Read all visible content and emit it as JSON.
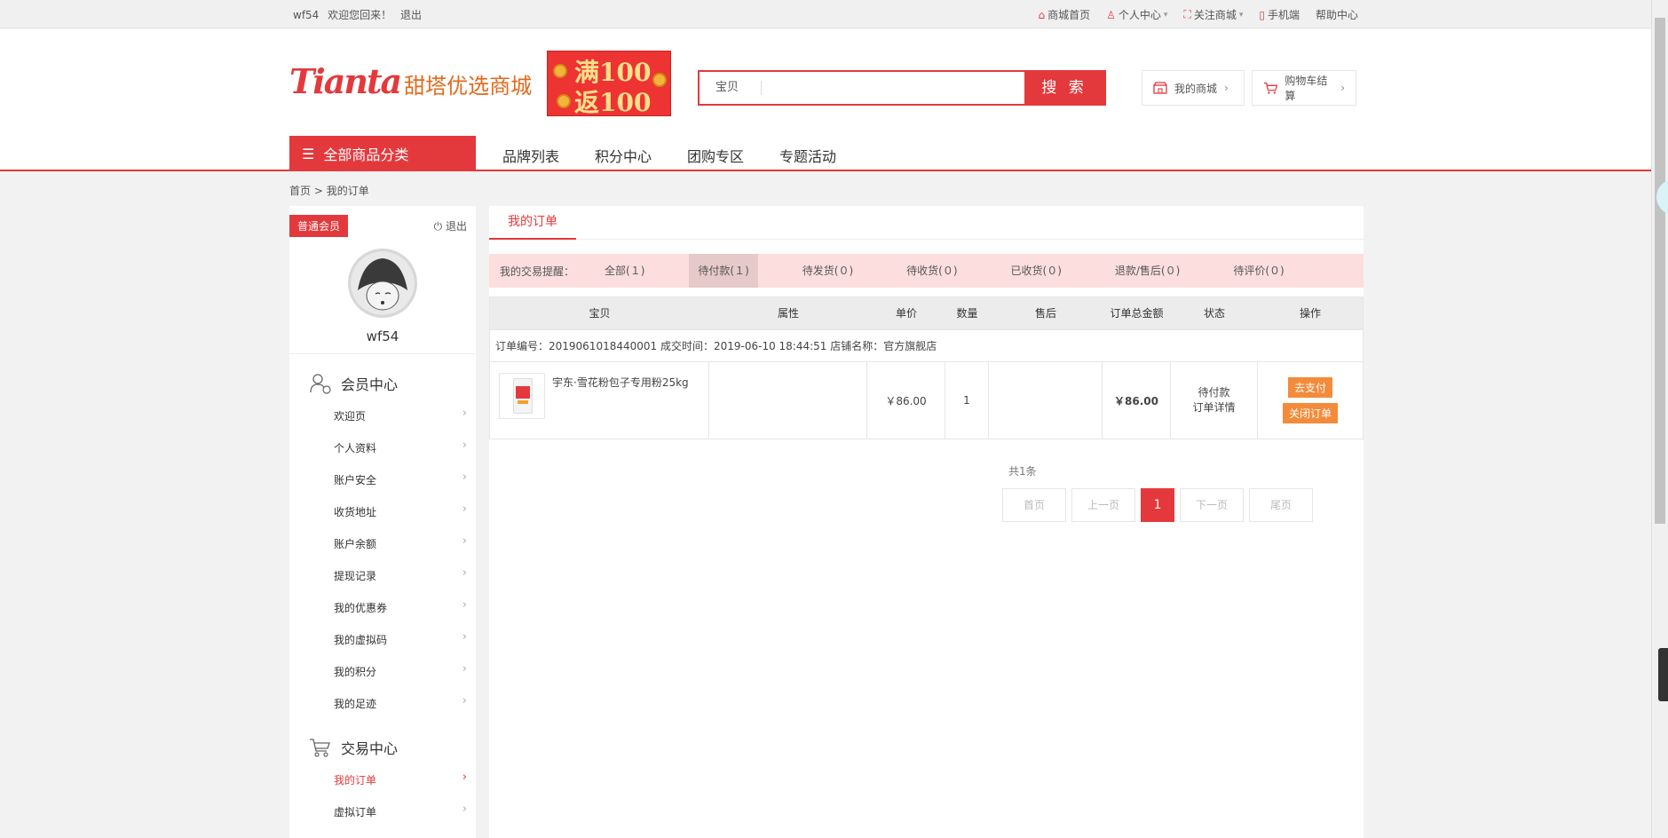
{
  "topbar": {
    "username": "wf54",
    "welcome": "欢迎您回来！",
    "logout": "退出",
    "links": [
      {
        "label": "商城首页",
        "icon": "home-icon"
      },
      {
        "label": "个人中心",
        "icon": "user-icon"
      },
      {
        "label": "关注商城",
        "icon": "follow-icon"
      },
      {
        "label": "手机端",
        "icon": "phone-icon"
      },
      {
        "label": "帮助中心",
        "icon": ""
      }
    ]
  },
  "header": {
    "logo_en": "Tianta",
    "logo_cn": "甜塔优选商城",
    "promo_line1": "满100",
    "promo_line2": "返100",
    "search": {
      "scope": "宝贝",
      "placeholder": "",
      "button": "搜 索"
    },
    "my_mall": "我的商城",
    "cart": "购物车结算"
  },
  "nav": {
    "all_categories": "全部商品分类",
    "items": [
      "品牌列表",
      "积分中心",
      "团购专区",
      "专题活动"
    ]
  },
  "breadcrumb": {
    "home": "首页",
    "sep": ">",
    "current": "我的订单"
  },
  "sidebar": {
    "badge": "普通会员",
    "logout": "退出",
    "username": "wf54",
    "sections": [
      {
        "title": "会员中心",
        "icon": "member-icon",
        "items": [
          "欢迎页",
          "个人资料",
          "账户安全",
          "收货地址",
          "账户余额",
          "提现记录",
          "我的优惠券",
          "我的虚拟码",
          "我的积分",
          "我的足迹"
        ]
      },
      {
        "title": "交易中心",
        "icon": "cart-icon",
        "items": [
          "我的订单",
          "虚拟订单"
        ]
      }
    ],
    "active_item": "我的订单"
  },
  "main": {
    "tab": "我的订单",
    "remind_label": "我的交易提醒：",
    "remind_tabs": [
      "全部(１)",
      "待付款(１)",
      "待发货(０)",
      "待收货(０)",
      "已收货(０)",
      "退款/售后(０)",
      "待评价(０)"
    ],
    "remind_selected": "待付款(１)",
    "columns": [
      "宝贝",
      "属性",
      "单价",
      "数量",
      "售后",
      "订单总金额",
      "状态",
      "操作"
    ],
    "order": {
      "info": "订单编号：2019061018440001    成交时间：2019-06-10 18:44:51    店铺名称：官方旗舰店",
      "product": "宇东·雪花粉包子专用粉25kg",
      "attr": "",
      "price": "￥86.00",
      "qty": "1",
      "after_sale": "",
      "total": "￥86.00",
      "status": "待付款",
      "detail": "订单详情",
      "pay_btn": "去支付",
      "close_btn": "关闭订单"
    },
    "pager": {
      "count": "共1条",
      "first": "首页",
      "prev": "上一页",
      "current": "1",
      "next": "下一页",
      "last": "尾页"
    }
  },
  "colors": {
    "accent": "#e4393c",
    "orange_button": "#f38b3a",
    "remind_bg": "#fcdede"
  }
}
